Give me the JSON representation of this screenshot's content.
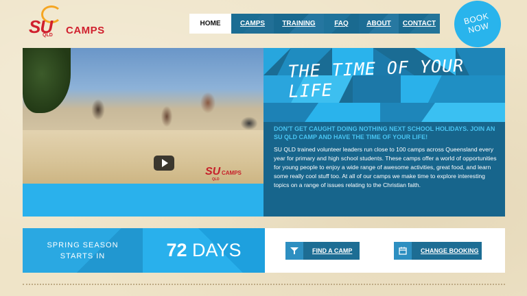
{
  "header": {
    "logo": {
      "su": "SU",
      "qld": "QLD",
      "camps": "CAMPS"
    },
    "nav": [
      {
        "label": "HOME",
        "active": true
      },
      {
        "label": "CAMPS"
      },
      {
        "label": "TRAINING"
      },
      {
        "label": "FAQ"
      },
      {
        "label": "ABOUT"
      },
      {
        "label": "CONTACT"
      }
    ],
    "book_now": {
      "line1": "BOOK",
      "line2": "NOW"
    }
  },
  "hero": {
    "video": {
      "watermark_su": "SU",
      "watermark_camps": "CAMPS",
      "watermark_qld": "QLD",
      "play_icon": "play-icon"
    },
    "tagline": "THE TIME OF YOUR LIFE",
    "lead": "DON'T GET CAUGHT DOING NOTHING NEXT SCHOOL HOLIDAYS. JOIN AN SU QLD CAMP AND HAVE THE TIME OF YOUR LIFE!",
    "body": "SU QLD trained volunteer leaders run close to 100 camps across Queensland every year for primary and high school students. These camps offer a world of opportunities for young people to enjoy a wide range of awesome activities, great food, and learn some really cool stuff too. At all of our camps we make time to explore interesting topics on a range of issues relating to the Christian faith."
  },
  "countdown": {
    "label_line1": "SPRING SEASON",
    "label_line2": "STARTS IN",
    "number": "72",
    "unit": "DAYS"
  },
  "actions": {
    "find": {
      "label": "FIND A CAMP",
      "icon": "filter-funnel-icon"
    },
    "change": {
      "label": "CHANGE BOOKING",
      "icon": "calendar-icon"
    }
  },
  "colors": {
    "accent": "#29b4ec",
    "navy": "#1d6d94",
    "logo_red": "#d0202e",
    "background": "#efe4c8"
  }
}
